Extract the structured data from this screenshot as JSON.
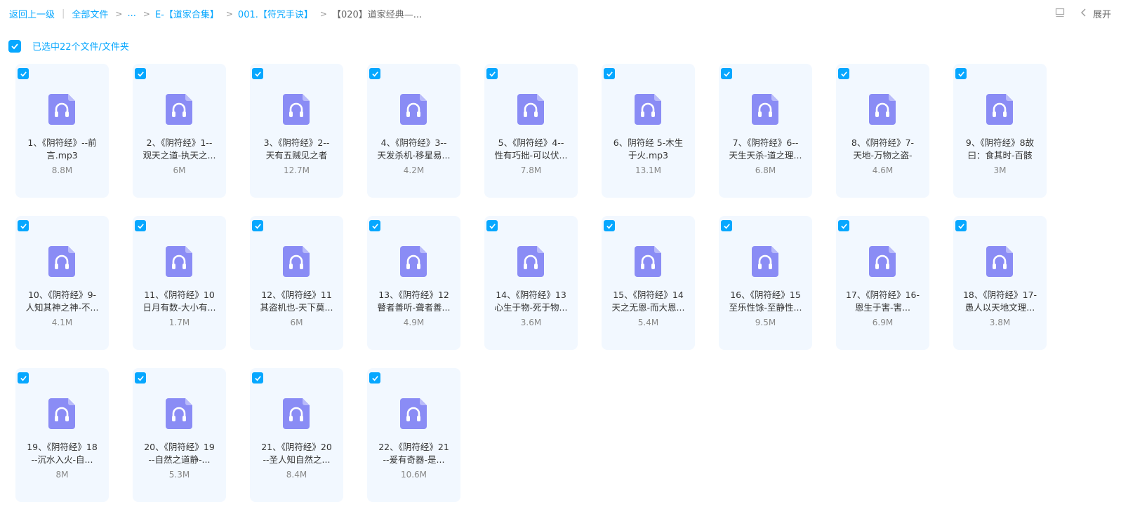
{
  "breadcrumb": {
    "back": "返回上一级",
    "all_files": "全部文件",
    "ellipsis": "...",
    "level1": "E-【道家合集】",
    "level2": "001.【符咒手诀】",
    "current": "【020】道家经典—..."
  },
  "toolbar": {
    "expand_label": "展开"
  },
  "selection": {
    "text": "已选中22个文件/文件夹"
  },
  "colors": {
    "accent": "#06a7ff",
    "card_bg": "#f2f8ff",
    "audio_icon": "#8a8cf5"
  },
  "files": [
    {
      "line1": "1、《阴符经》--前",
      "line2": "言.mp3",
      "size": "8.8M",
      "icon": "audio-file-icon"
    },
    {
      "line1": "2、《阴符经》1--",
      "line2": "观天之道-执天之...",
      "size": "6M",
      "icon": "audio-file-icon"
    },
    {
      "line1": "3、《阴符经》2--",
      "line2": "天有五贼见之者",
      "size": "12.7M",
      "icon": "audio-file-icon"
    },
    {
      "line1": "4、《阴符经》3--",
      "line2": "天发杀机-移星易...",
      "size": "4.2M",
      "icon": "audio-file-icon"
    },
    {
      "line1": "5、《阴符经》4--",
      "line2": "性有巧拙-可以伏...",
      "size": "7.8M",
      "icon": "audio-file-icon"
    },
    {
      "line1": "6、阴符经 5-木生",
      "line2": "于火.mp3",
      "size": "13.1M",
      "icon": "audio-file-icon"
    },
    {
      "line1": "7、《阴符经》6--",
      "line2": "天生天杀-道之理...",
      "size": "6.8M",
      "icon": "audio-file-icon"
    },
    {
      "line1": "8、《阴符经》7-",
      "line2": "天地-万物之盗-",
      "size": "4.6M",
      "icon": "audio-file-icon"
    },
    {
      "line1": "9、《阴符经》8故",
      "line2": "曰：食其时-百骸",
      "size": "3M",
      "icon": "audio-file-icon"
    },
    {
      "line1": "10、《阴符经》9-",
      "line2": "人知其神之神-不...",
      "size": "4.1M",
      "icon": "audio-file-icon"
    },
    {
      "line1": "11、《阴符经》10",
      "line2": "日月有数-大小有...",
      "size": "1.7M",
      "icon": "audio-file-icon"
    },
    {
      "line1": "12、《阴符经》11",
      "line2": "其盗机也-天下莫...",
      "size": "6M",
      "icon": "audio-file-icon"
    },
    {
      "line1": "13、《阴符经》12",
      "line2": "瞽者善听-聋者善...",
      "size": "4.9M",
      "icon": "audio-file-icon"
    },
    {
      "line1": "14、《阴符经》13",
      "line2": "心生于物-死于物...",
      "size": "3.6M",
      "icon": "audio-file-icon"
    },
    {
      "line1": "15、《阴符经》14",
      "line2": "天之无恩-而大恩...",
      "size": "5.4M",
      "icon": "audio-file-icon"
    },
    {
      "line1": "16、《阴符经》15",
      "line2": "至乐性馀-至静性...",
      "size": "9.5M",
      "icon": "audio-file-icon"
    },
    {
      "line1": "17、《阴符经》16-",
      "line2": "恩生于害-害...",
      "size": "6.9M",
      "icon": "audio-file-icon"
    },
    {
      "line1": "18、《阴符经》17-",
      "line2": "愚人以天地文理...",
      "size": "3.8M",
      "icon": "audio-file-icon"
    },
    {
      "line1": "19、《阴符经》18",
      "line2": "--沉水入火-自...",
      "size": "8M",
      "icon": "audio-file-icon"
    },
    {
      "line1": "20、《阴符经》19",
      "line2": "--自然之道静-...",
      "size": "5.3M",
      "icon": "audio-file-icon"
    },
    {
      "line1": "21、《阴符经》20",
      "line2": "--圣人知自然之...",
      "size": "8.4M",
      "icon": "audio-file-icon"
    },
    {
      "line1": "22、《阴符经》21",
      "line2": "--爰有奇器-是...",
      "size": "10.6M",
      "icon": "audio-file-icon"
    }
  ]
}
